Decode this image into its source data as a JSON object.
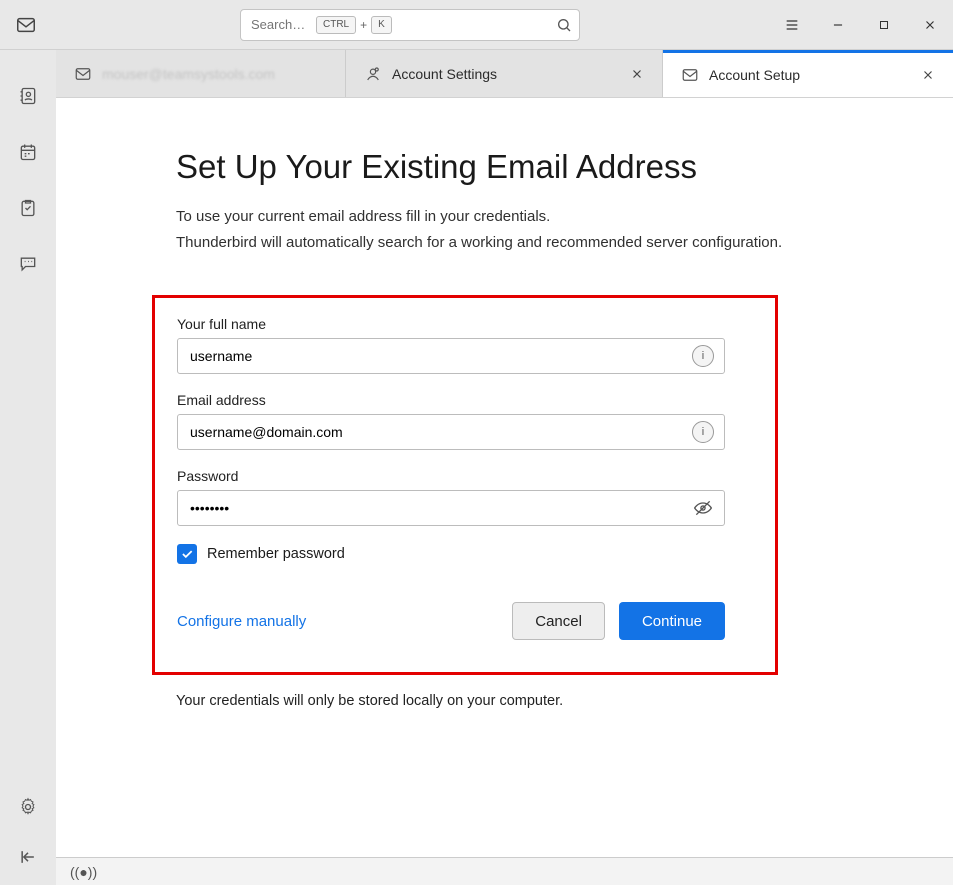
{
  "search": {
    "placeholder": "Search…",
    "shortcut_key1": "CTRL",
    "shortcut_plus": "+",
    "shortcut_key2": "K"
  },
  "tabs": {
    "account_blurred": "mouser@teamsystools.com",
    "settings_label": "Account Settings",
    "setup_label": "Account Setup"
  },
  "page": {
    "title": "Set Up Your Existing Email Address",
    "intro_line1": "To use your current email address fill in your credentials.",
    "intro_line2": "Thunderbird will automatically search for a working and recommended server configuration."
  },
  "form": {
    "fullname_label": "Your full name",
    "fullname_value": "username",
    "email_label": "Email address",
    "email_value": "username@domain.com",
    "password_label": "Password",
    "password_value": "••••••••",
    "remember_label": "Remember password",
    "configure_manually": "Configure manually",
    "cancel": "Cancel",
    "continue": "Continue"
  },
  "footnote": "Your credentials will only be stored locally on your computer.",
  "icons": {
    "info_letter": "i"
  }
}
